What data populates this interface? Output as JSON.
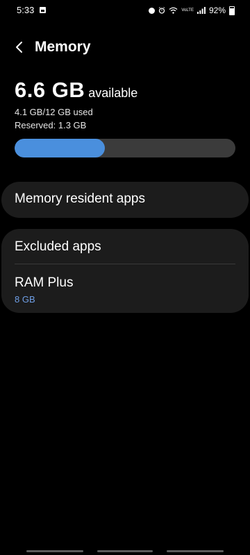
{
  "status_bar": {
    "time": "5:33",
    "battery": "92%",
    "network_label": "VoLTE",
    "icons": [
      "gallery-icon",
      "record-icon",
      "alarm-icon",
      "wifi-icon",
      "signal-icon",
      "battery-icon"
    ]
  },
  "header": {
    "back_icon": "back-chevron-icon",
    "title": "Memory"
  },
  "memory": {
    "available_value": "6.6 GB",
    "available_label": "available",
    "used": "4.1 GB/12 GB used",
    "reserved": "Reserved: 1.3 GB",
    "usage_fraction": 0.41,
    "bar_fill_color": "#4a8fdd",
    "bar_track_color": "#3b3b3b"
  },
  "items": {
    "memory_resident_apps": "Memory resident apps",
    "excluded_apps": "Excluded apps",
    "ram_plus": "RAM Plus",
    "ram_plus_value": "8 GB"
  },
  "colors": {
    "background": "#000000",
    "card": "#1c1c1c",
    "accent_text": "#6f9fe6"
  }
}
